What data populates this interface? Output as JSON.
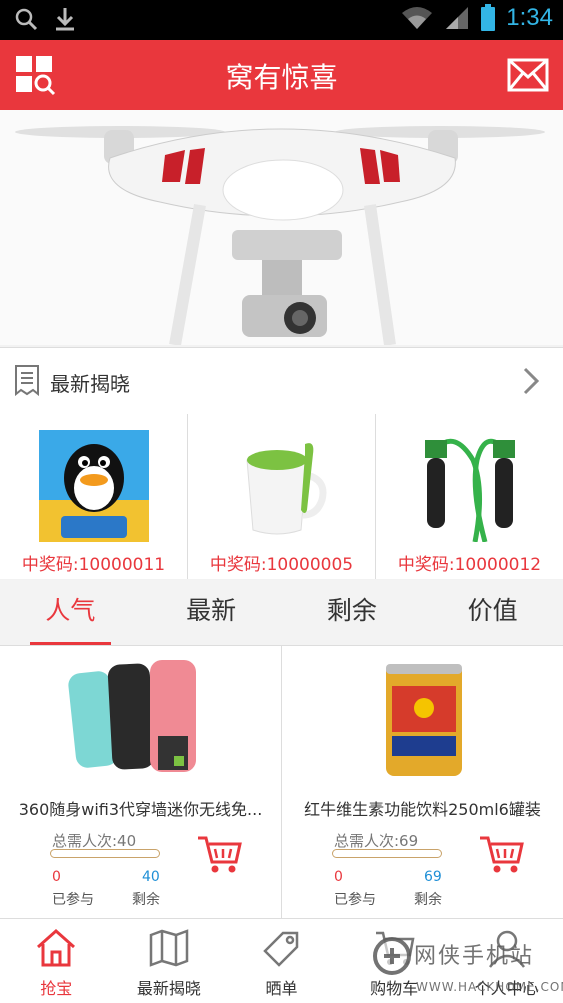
{
  "status_bar": {
    "time": "1:34",
    "icons": [
      "search-icon",
      "download-icon",
      "wifi-icon",
      "signal-icon",
      "battery-icon"
    ]
  },
  "header": {
    "title": "窝有惊喜",
    "left_icon": "grid-search-icon",
    "right_icon": "mail-icon"
  },
  "banner": {
    "image": "drone-photo"
  },
  "latest_reveal": {
    "label": "最新揭晓"
  },
  "winners": [
    {
      "code": "中奖码:10000011",
      "image": "qq-coin"
    },
    {
      "code": "中奖码:10000005",
      "image": "green-mug"
    },
    {
      "code": "中奖码:10000012",
      "image": "jump-rope"
    }
  ],
  "tabs": [
    {
      "label": "人气",
      "active": true
    },
    {
      "label": "最新",
      "active": false
    },
    {
      "label": "剩余",
      "active": false
    },
    {
      "label": "价值",
      "active": false
    }
  ],
  "products": [
    {
      "name": "360随身wifi3代穿墙迷你无线免...",
      "need_label": "总需人次:40",
      "progress": 0,
      "joined_value": "0",
      "remain_value": "40",
      "joined_label": "已参与",
      "remain_label": "剩余",
      "image": "usb-wifi-sticks"
    },
    {
      "name": "红牛维生素功能饮料250ml6罐装",
      "need_label": "总需人次:69",
      "progress": 0,
      "joined_value": "0",
      "remain_value": "69",
      "joined_label": "已参与",
      "remain_label": "剩余",
      "image": "red-bull-can"
    }
  ],
  "bottom_nav": [
    {
      "label": "抢宝",
      "icon": "home-icon",
      "active": true
    },
    {
      "label": "最新揭晓",
      "icon": "map-icon",
      "active": false
    },
    {
      "label": "晒单",
      "icon": "tag-icon",
      "active": false
    },
    {
      "label": "购物车",
      "icon": "cart-icon",
      "active": false
    },
    {
      "label": "个人中心",
      "icon": "user-icon",
      "active": false
    }
  ],
  "watermark": {
    "line1": "网侠手机站",
    "line2": "WWW.HACKHOME.COM"
  },
  "colors": {
    "accent": "#e9373d",
    "remain_blue": "#1f8fd6",
    "status_blue": "#33b5e5"
  }
}
